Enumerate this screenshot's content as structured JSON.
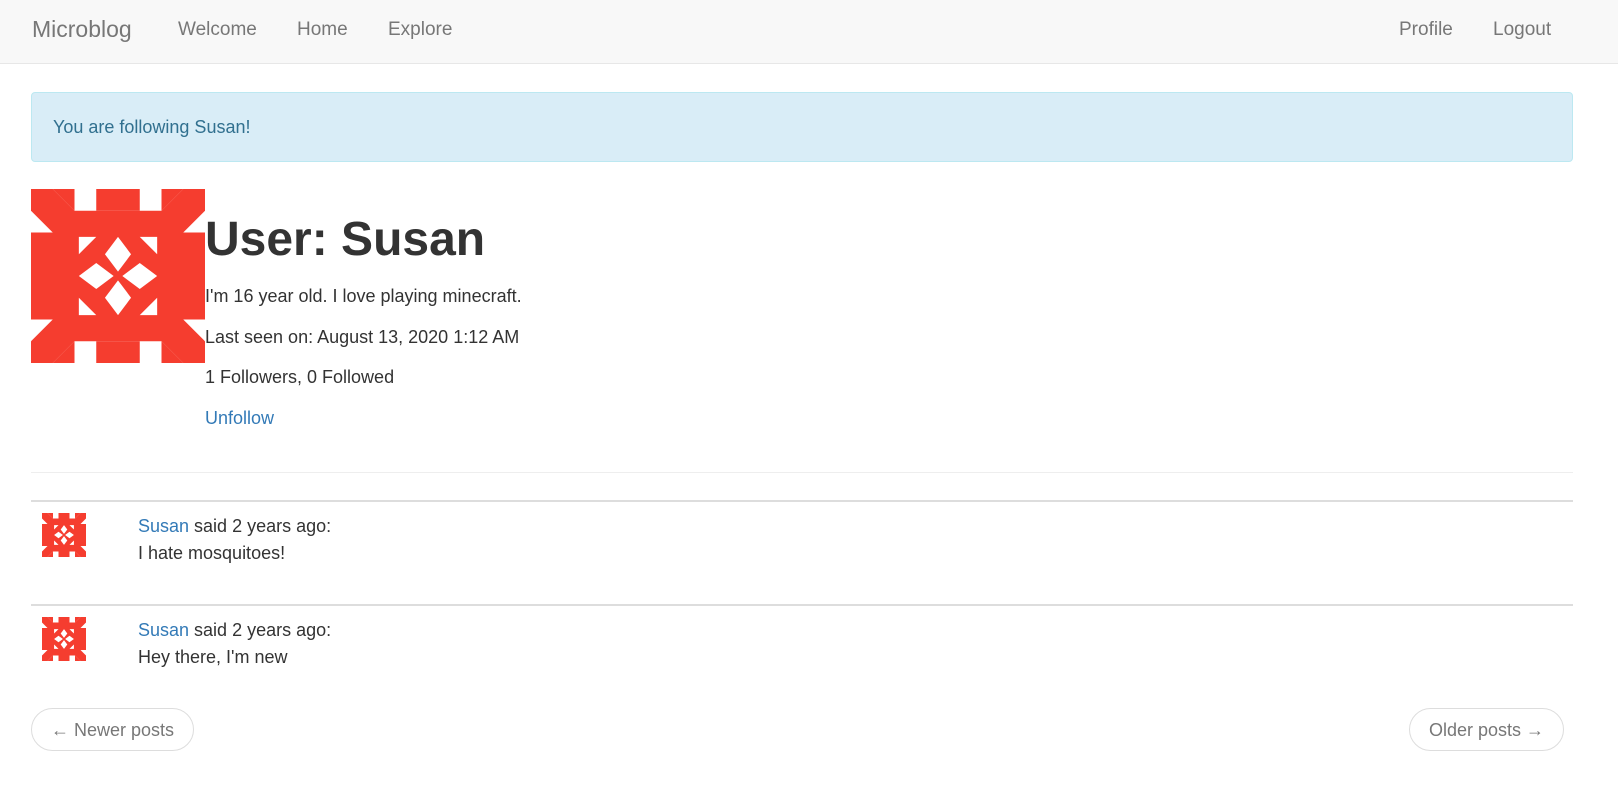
{
  "navbar": {
    "brand": "Microblog",
    "links": {
      "welcome": "Welcome",
      "home": "Home",
      "explore": "Explore",
      "profile": "Profile",
      "logout": "Logout"
    }
  },
  "alert": {
    "message": "You are following Susan!"
  },
  "profile": {
    "avatar_icon": "identicon-avatar",
    "title": "User: Susan",
    "about": "I'm 16 year old. I love playing minecraft.",
    "last_seen": "Last seen on: August 13, 2020 1:12 AM",
    "follow_counts": "1 Followers, 0 Followed",
    "unfollow_label": "Unfollow"
  },
  "posts": [
    {
      "author": "Susan",
      "meta": " said 2 years ago:",
      "body": "I hate mosquitoes!"
    },
    {
      "author": "Susan",
      "meta": " said 2 years ago:",
      "body": "Hey there, I'm new"
    }
  ],
  "pagination": {
    "newer": "← Newer posts",
    "older": "Older posts →"
  },
  "colors": {
    "accent": "#337ab7",
    "avatar": "#f53d2f",
    "alert_bg": "#d9edf7"
  }
}
